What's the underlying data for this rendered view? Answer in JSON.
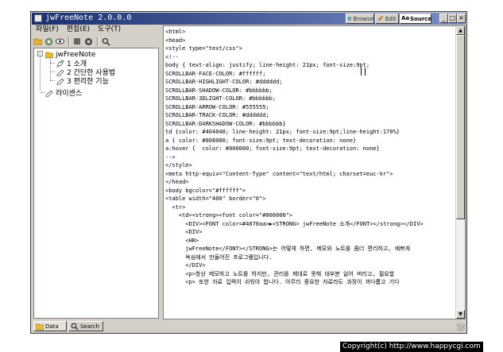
{
  "window": {
    "title": "jwFreeNote 2.0.0.0",
    "mode_buttons": [
      {
        "label": "Browse",
        "icon": "browse-icon"
      },
      {
        "label": "Edit",
        "icon": "edit-icon"
      },
      {
        "label": "Source",
        "icon": "source-icon",
        "active": true
      }
    ],
    "controls": [
      "minimize-icon",
      "maximize-icon",
      "close-icon"
    ]
  },
  "menu": [
    "파일(F)",
    "편집(E)",
    "도구(T)"
  ],
  "toolbar": [
    "open-folder-icon",
    "settings-icon",
    "eye-icon",
    "stop-icon",
    "save-icon",
    "search-icon"
  ],
  "tree": {
    "root": "jwFreeNote",
    "children": [
      "1 소개",
      "2 간단한 사용법",
      "3 편리한 기능"
    ],
    "sibling": "라이센스"
  },
  "tabs": [
    {
      "label": "Data",
      "icon": "data-tab-icon",
      "active": true
    },
    {
      "label": "Search",
      "icon": "search-tab-icon"
    }
  ],
  "editor": {
    "lines": [
      "<html>",
      "<head>",
      "<style type=\"text/css\">",
      "<!--",
      "body { text-align: justify; line-height: 21px; font-size:9pt;",
      "SCROLLBAR-FACE-COLOR: #ffffff;",
      "SCROLLBAR-HIGHLIGHT-COLOR: #dddddd;",
      "SCROLLBAR-SHADOW-COLOR: #bbbbbb;",
      "SCROLLBAR-3DLIGHT-COLOR: #bbbbbb;",
      "SCROLLBAR-ARROW-COLOR: #555555;",
      "SCROLLBAR-TRACK-COLOR: #dddddd;",
      "SCROLLBAR-DARKSHADOW-COLOR: #bbbbbb}",
      "td {color: #404040; line-height: 21px; font-size:9pt;line-height:170%}",
      "a { color: #808080; font-size:9pt; text-decoration: none}",
      "a:hover {  color: #000000; font-size:9pt; text-decoration: none}",
      "-->",
      "</style>",
      "<meta http-equiv=\"Content-Type\" content=\"text/html; charset=euc-kr\">",
      "</head>",
      "<body bgcolor=\"#ffffff\">",
      "<table width=\"400\" border=\"0\">",
      "  <tr>",
      "    <td><strong><font color=\"#800000\">",
      "      <DIV><FONT color=#4070aa>▶<STRONG> jwFreeNote 소개</FONT></strong></DIV>",
      "      <DIV>",
      "      <HR>",
      "      jwFreeNote</FONT></STRONG>는 어떻게 하면, 메모와 노트를 좀더 편리하고, 예쁘게",
      "      옥심에서 만들어진 프로그램입니다.",
      "      </DIV>",
      "      <p>항상 메모하고 노트를 하지만, 관리를 제대로 못해 대부분 잃어 버리고, 필요할",
      "      <p> 또한 자료 입력이 쉬워야 합니다. 아무리 중요한 자료라도 과정이 까다롭고 기다"
    ]
  },
  "footer": {
    "copyright": "Copyright(c) http://www.happycgi.com"
  },
  "colors": {
    "titlebar_start": "#1a2f6e",
    "titlebar_end": "#7a8fc8",
    "face": "#d4d0c8"
  }
}
